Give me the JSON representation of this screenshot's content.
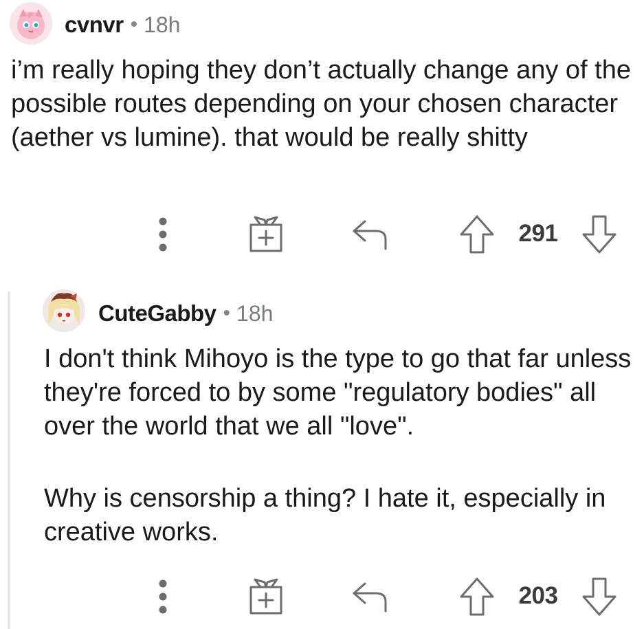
{
  "comments": [
    {
      "username": "cvnvr",
      "separator": "•",
      "time": "18h",
      "body": "i’m really hoping they don’t actually change any of the possible routes depending on your chosen character (aether vs lumine). that would be really shitty",
      "score": "291",
      "avatar_icon": "pink-balloon-creature-avatar"
    },
    {
      "username": "CuteGabby",
      "separator": "•",
      "time": "18h",
      "paragraphs": [
        "I don't think Mihoyo is the type to go that far unless they're forced to by some \"regulatory bodies\" all over the world that we all \"love\".",
        "Why is censorship a thing? I hate it, especially in creative works."
      ],
      "score": "203",
      "avatar_icon": "blonde-anime-girl-avatar"
    }
  ],
  "icons": {
    "more": "vertical-dots-icon",
    "award": "gift-box-icon",
    "reply": "reply-arrow-icon",
    "upvote": "upvote-arrow-icon",
    "downvote": "downvote-arrow-icon"
  },
  "colors": {
    "text": "#1a1a1b",
    "meta": "#787c7e",
    "icon": "#6b6e70",
    "thread_line": "#e6e6e6"
  }
}
